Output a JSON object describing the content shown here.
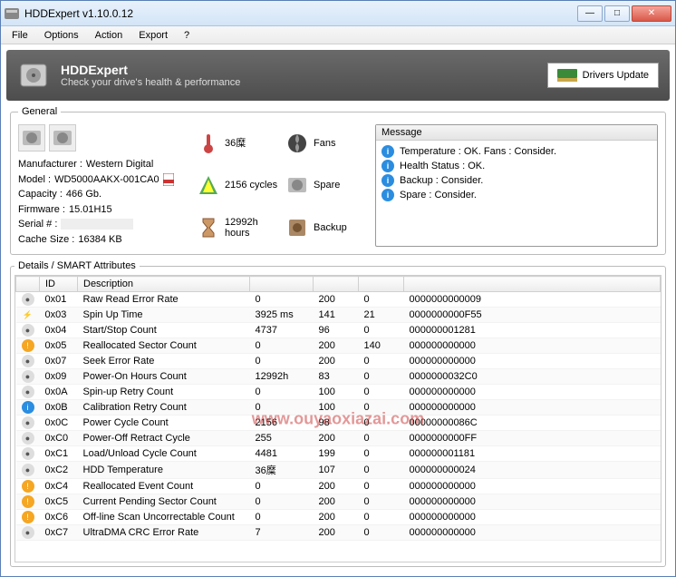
{
  "window": {
    "title": "HDDExpert v1.10.0.12"
  },
  "menu": {
    "file": "File",
    "options": "Options",
    "action": "Action",
    "export": "Export",
    "help": "?"
  },
  "banner": {
    "title": "HDDExpert",
    "subtitle": "Check your drive's health & performance",
    "drivers_btn": "Drivers Update"
  },
  "general": {
    "legend": "General",
    "manufacturer_label": "Manufacturer :",
    "manufacturer": "Western Digital",
    "model_label": "Model :",
    "model": "WD5000AAKX-001CA0",
    "capacity_label": "Capacity :",
    "capacity": "466 Gb.",
    "firmware_label": "Firmware :",
    "firmware": "15.01H15",
    "serial_label": "Serial # :",
    "serial": "",
    "cache_label": "Cache Size :",
    "cache": "16384 KB",
    "stats": {
      "temp": "36糜",
      "fans": "Fans",
      "cycles": "2156 cycles",
      "spare": "Spare",
      "hours": "12992h hours",
      "backup": "Backup"
    }
  },
  "messages": {
    "header": "Message",
    "rows": [
      "Temperature : OK. Fans : Consider.",
      "Health Status : OK.",
      "Backup : Consider.",
      "Spare : Consider."
    ]
  },
  "details": {
    "legend": "Details / SMART Attributes",
    "cols": {
      "id": "ID",
      "desc": "Description",
      "c3": "",
      "c4": "",
      "c5": "",
      "c6": ""
    },
    "rows": [
      {
        "ico": "ok",
        "id": "0x01",
        "desc": "Raw Read Error Rate",
        "v1": "0",
        "v2": "200",
        "v3": "0",
        "v4": "0000000000009"
      },
      {
        "ico": "spark",
        "id": "0x03",
        "desc": "Spin Up Time",
        "v1": "3925 ms",
        "v2": "141",
        "v3": "21",
        "v4": "0000000000F55"
      },
      {
        "ico": "ok",
        "id": "0x04",
        "desc": "Start/Stop Count",
        "v1": "4737",
        "v2": "96",
        "v3": "0",
        "v4": "000000001281"
      },
      {
        "ico": "warn",
        "id": "0x05",
        "desc": "Reallocated Sector Count",
        "v1": "0",
        "v2": "200",
        "v3": "140",
        "v4": "000000000000"
      },
      {
        "ico": "ok",
        "id": "0x07",
        "desc": "Seek Error Rate",
        "v1": "0",
        "v2": "200",
        "v3": "0",
        "v4": "000000000000"
      },
      {
        "ico": "ok",
        "id": "0x09",
        "desc": "Power-On Hours Count",
        "v1": "12992h",
        "v2": "83",
        "v3": "0",
        "v4": "0000000032C0"
      },
      {
        "ico": "ok",
        "id": "0x0A",
        "desc": "Spin-up Retry Count",
        "v1": "0",
        "v2": "100",
        "v3": "0",
        "v4": "000000000000"
      },
      {
        "ico": "info",
        "id": "0x0B",
        "desc": "Calibration Retry Count",
        "v1": "0",
        "v2": "100",
        "v3": "0",
        "v4": "000000000000"
      },
      {
        "ico": "ok",
        "id": "0x0C",
        "desc": "Power Cycle Count",
        "v1": "2156",
        "v2": "98",
        "v3": "0",
        "v4": "00000000086C"
      },
      {
        "ico": "ok",
        "id": "0xC0",
        "desc": "Power-Off Retract Cycle",
        "v1": "255",
        "v2": "200",
        "v3": "0",
        "v4": "0000000000FF"
      },
      {
        "ico": "ok",
        "id": "0xC1",
        "desc": "Load/Unload Cycle Count",
        "v1": "4481",
        "v2": "199",
        "v3": "0",
        "v4": "000000001181"
      },
      {
        "ico": "ok",
        "id": "0xC2",
        "desc": "HDD Temperature",
        "v1": "36糜",
        "v2": "107",
        "v3": "0",
        "v4": "000000000024"
      },
      {
        "ico": "warn",
        "id": "0xC4",
        "desc": "Reallocated Event Count",
        "v1": "0",
        "v2": "200",
        "v3": "0",
        "v4": "000000000000"
      },
      {
        "ico": "warn",
        "id": "0xC5",
        "desc": "Current Pending Sector Count",
        "v1": "0",
        "v2": "200",
        "v3": "0",
        "v4": "000000000000"
      },
      {
        "ico": "warn",
        "id": "0xC6",
        "desc": "Off-line Scan Uncorrectable Count",
        "v1": "0",
        "v2": "200",
        "v3": "0",
        "v4": "000000000000"
      },
      {
        "ico": "ok",
        "id": "0xC7",
        "desc": "UltraDMA CRC Error Rate",
        "v1": "7",
        "v2": "200",
        "v3": "0",
        "v4": "000000000000"
      }
    ]
  },
  "watermark": "www.ouyaoxiazai.com"
}
